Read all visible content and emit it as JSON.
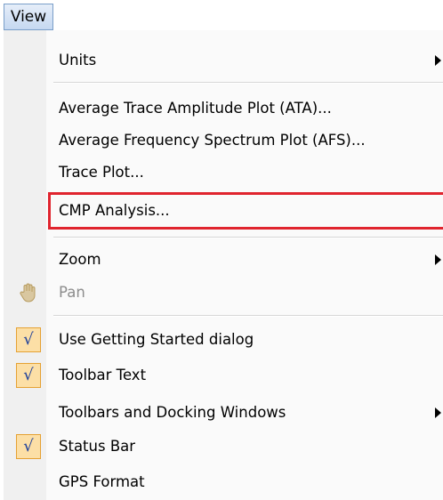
{
  "menubar": {
    "view_label": "View"
  },
  "menu": {
    "units": "Units",
    "ata": "Average Trace Amplitude Plot (ATA)...",
    "afs": "Average Frequency Spectrum Plot (AFS)...",
    "trace_plot": "Trace Plot...",
    "cmp_analysis": "CMP Analysis...",
    "zoom": "Zoom",
    "pan": "Pan",
    "use_getting_started": "Use Getting Started dialog",
    "toolbar_text": "Toolbar Text",
    "toolbars_docking": "Toolbars and Docking Windows",
    "status_bar": "Status Bar",
    "gps_format": "GPS Format"
  },
  "checks": {
    "use_getting_started": true,
    "toolbar_text": true,
    "status_bar": true
  },
  "check_glyph": "√",
  "colors": {
    "highlight_outline": "#e0242e",
    "check_background": "#fcdfa6",
    "check_border": "#e5a133",
    "disabled_text": "#8d8d8d"
  }
}
